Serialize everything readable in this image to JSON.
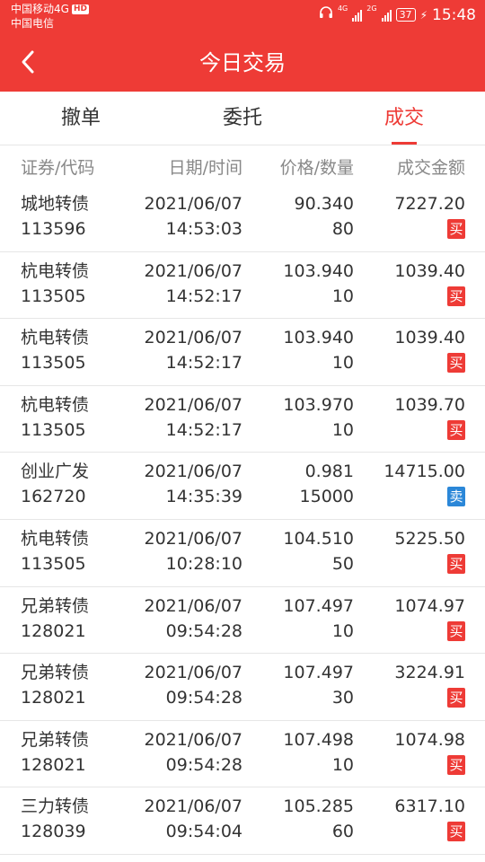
{
  "status_bar": {
    "carrier1": "中国移动4G",
    "hd_badge": "HD",
    "carrier2": "中国电信",
    "net1": "4G",
    "net2": "2G",
    "battery": "37",
    "time": "15:48"
  },
  "header": {
    "title": "今日交易",
    "back_icon": "chevron-left-icon"
  },
  "tabs": [
    {
      "label": "撤单",
      "active": false
    },
    {
      "label": "委托",
      "active": false
    },
    {
      "label": "成交",
      "active": true
    }
  ],
  "columns": {
    "security": "证券/代码",
    "datetime": "日期/时间",
    "price_qty": "价格/数量",
    "amount": "成交金额"
  },
  "colors": {
    "accent": "#ee3b36",
    "buy": "#ee3b36",
    "sell": "#2b87d8"
  },
  "trades": [
    {
      "name": "城地转债",
      "code": "113596",
      "date": "2021/06/07",
      "time": "14:53:03",
      "price": "90.340",
      "qty": "80",
      "amount": "7227.20",
      "side": "买"
    },
    {
      "name": "杭电转债",
      "code": "113505",
      "date": "2021/06/07",
      "time": "14:52:17",
      "price": "103.940",
      "qty": "10",
      "amount": "1039.40",
      "side": "买"
    },
    {
      "name": "杭电转债",
      "code": "113505",
      "date": "2021/06/07",
      "time": "14:52:17",
      "price": "103.940",
      "qty": "10",
      "amount": "1039.40",
      "side": "买"
    },
    {
      "name": "杭电转债",
      "code": "113505",
      "date": "2021/06/07",
      "time": "14:52:17",
      "price": "103.970",
      "qty": "10",
      "amount": "1039.70",
      "side": "买"
    },
    {
      "name": "创业广发",
      "code": "162720",
      "date": "2021/06/07",
      "time": "14:35:39",
      "price": "0.981",
      "qty": "15000",
      "amount": "14715.00",
      "side": "卖"
    },
    {
      "name": "杭电转债",
      "code": "113505",
      "date": "2021/06/07",
      "time": "10:28:10",
      "price": "104.510",
      "qty": "50",
      "amount": "5225.50",
      "side": "买"
    },
    {
      "name": "兄弟转债",
      "code": "128021",
      "date": "2021/06/07",
      "time": "09:54:28",
      "price": "107.497",
      "qty": "10",
      "amount": "1074.97",
      "side": "买"
    },
    {
      "name": "兄弟转债",
      "code": "128021",
      "date": "2021/06/07",
      "time": "09:54:28",
      "price": "107.497",
      "qty": "30",
      "amount": "3224.91",
      "side": "买"
    },
    {
      "name": "兄弟转债",
      "code": "128021",
      "date": "2021/06/07",
      "time": "09:54:28",
      "price": "107.498",
      "qty": "10",
      "amount": "1074.98",
      "side": "买"
    },
    {
      "name": "三力转债",
      "code": "128039",
      "date": "2021/06/07",
      "time": "09:54:04",
      "price": "105.285",
      "qty": "60",
      "amount": "6317.10",
      "side": "买"
    }
  ]
}
